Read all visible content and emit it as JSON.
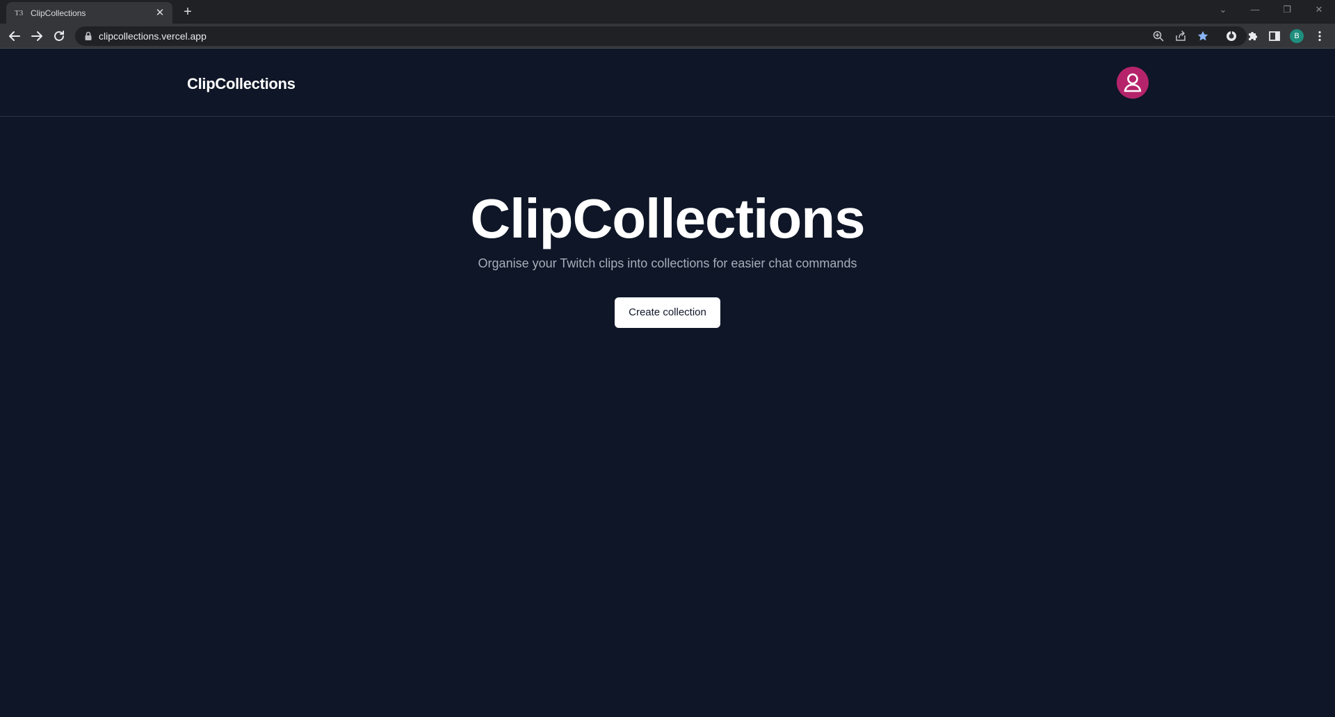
{
  "browser": {
    "tab": {
      "favicon": "T3",
      "title": "ClipCollections",
      "close_icon": "close-icon"
    },
    "new_tab_icon": "plus-icon",
    "window_controls": [
      "chevron-down-icon",
      "minimize-icon",
      "restore-icon",
      "close-icon"
    ],
    "nav": [
      "back-arrow-icon",
      "forward-arrow-icon",
      "reload-icon"
    ],
    "address_bar": {
      "url": "clipcollections.vercel.app",
      "lock_icon": "lock-icon"
    },
    "omnibox_icons": [
      "zoom-icon",
      "share-icon",
      "bookmark-star-icon"
    ],
    "toolbar_icons": [
      "extension-icon",
      "puzzle-icon",
      "side-panel-icon",
      "kebab-menu-icon"
    ],
    "profile_initial": "B",
    "colors": {
      "star": "#8ab4f8",
      "profile": "#1e8e7e"
    }
  },
  "site": {
    "brand": "ClipCollections",
    "avatar_icon": "user-icon",
    "avatar_color": "#b5246b",
    "background": "#0e1627"
  },
  "hero": {
    "title": "ClipCollections",
    "subtitle": "Organise your Twitch clips into collections for easier chat commands",
    "cta_label": "Create collection"
  }
}
